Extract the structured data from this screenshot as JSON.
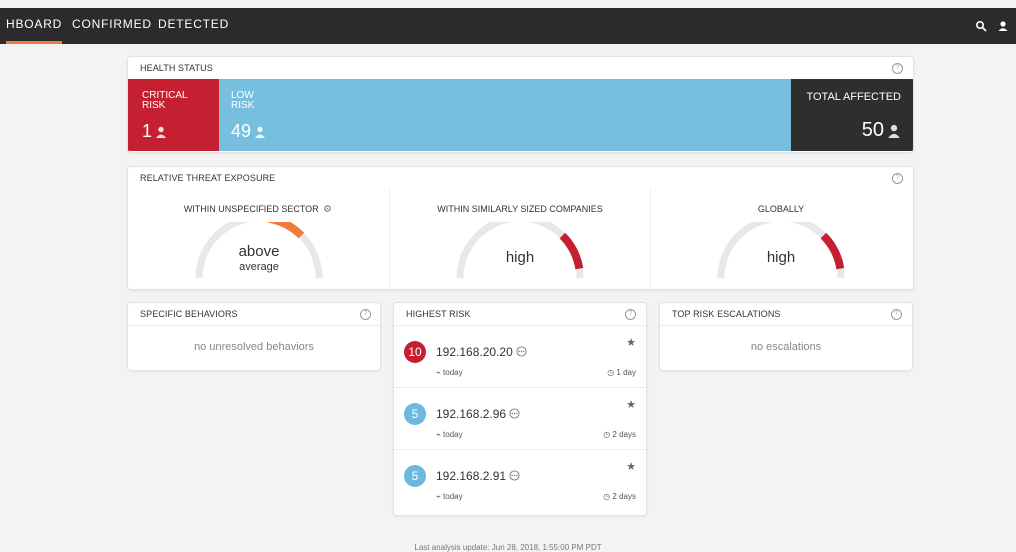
{
  "nav": {
    "tabs": [
      {
        "label": "HBOARD"
      },
      {
        "label": "CONFIRMED"
      },
      {
        "label": "DETECTED"
      }
    ],
    "icons": [
      "search-icon",
      "user-icon"
    ]
  },
  "health_status": {
    "title": "HEALTH STATUS",
    "critical": {
      "label_line1": "CRITICAL",
      "label_line2": "RISK",
      "count": "1"
    },
    "low": {
      "label_line1": "LOW",
      "label_line2": "RISK",
      "count": "49"
    },
    "total": {
      "label": "TOTAL AFFECTED",
      "count": "50"
    },
    "colors": {
      "critical": "#c42032",
      "low": "#77bfdf",
      "total": "#2e2e2e"
    }
  },
  "threat_exposure": {
    "title": "RELATIVE THREAT EXPOSURE",
    "gauges": [
      {
        "label": "WITHIN UNSPECIFIED SECTOR",
        "value_line1": "above",
        "value_line2": "average",
        "level": 0.75,
        "color": "#f07b3f"
      },
      {
        "label": "WITHIN SIMILARLY SIZED COMPANIES",
        "value_line1": "high",
        "value_line2": "",
        "level": 0.95,
        "color": "#c42032"
      },
      {
        "label": "GLOBALLY",
        "value_line1": "high",
        "value_line2": "",
        "level": 0.95,
        "color": "#c42032"
      }
    ]
  },
  "specific_behaviors": {
    "title": "SPECIFIC BEHAVIORS",
    "empty": "no unresolved behaviors"
  },
  "highest_risk": {
    "title": "HIGHEST RISK",
    "items": [
      {
        "score": "10",
        "ip": "192.168.20.20",
        "when": "today",
        "age": "1 day",
        "color": "#c42032"
      },
      {
        "score": "5",
        "ip": "192.168.2.96",
        "when": "today",
        "age": "2 days",
        "color": "#6db8dd"
      },
      {
        "score": "5",
        "ip": "192.168.2.91",
        "when": "today",
        "age": "2 days",
        "color": "#6db8dd"
      }
    ]
  },
  "top_risk_escalations": {
    "title": "TOP RISK ESCALATIONS",
    "empty": "no escalations"
  },
  "footer": {
    "text": "Last analysis update: Jun 28, 2018, 1:55:00 PM PDT"
  }
}
